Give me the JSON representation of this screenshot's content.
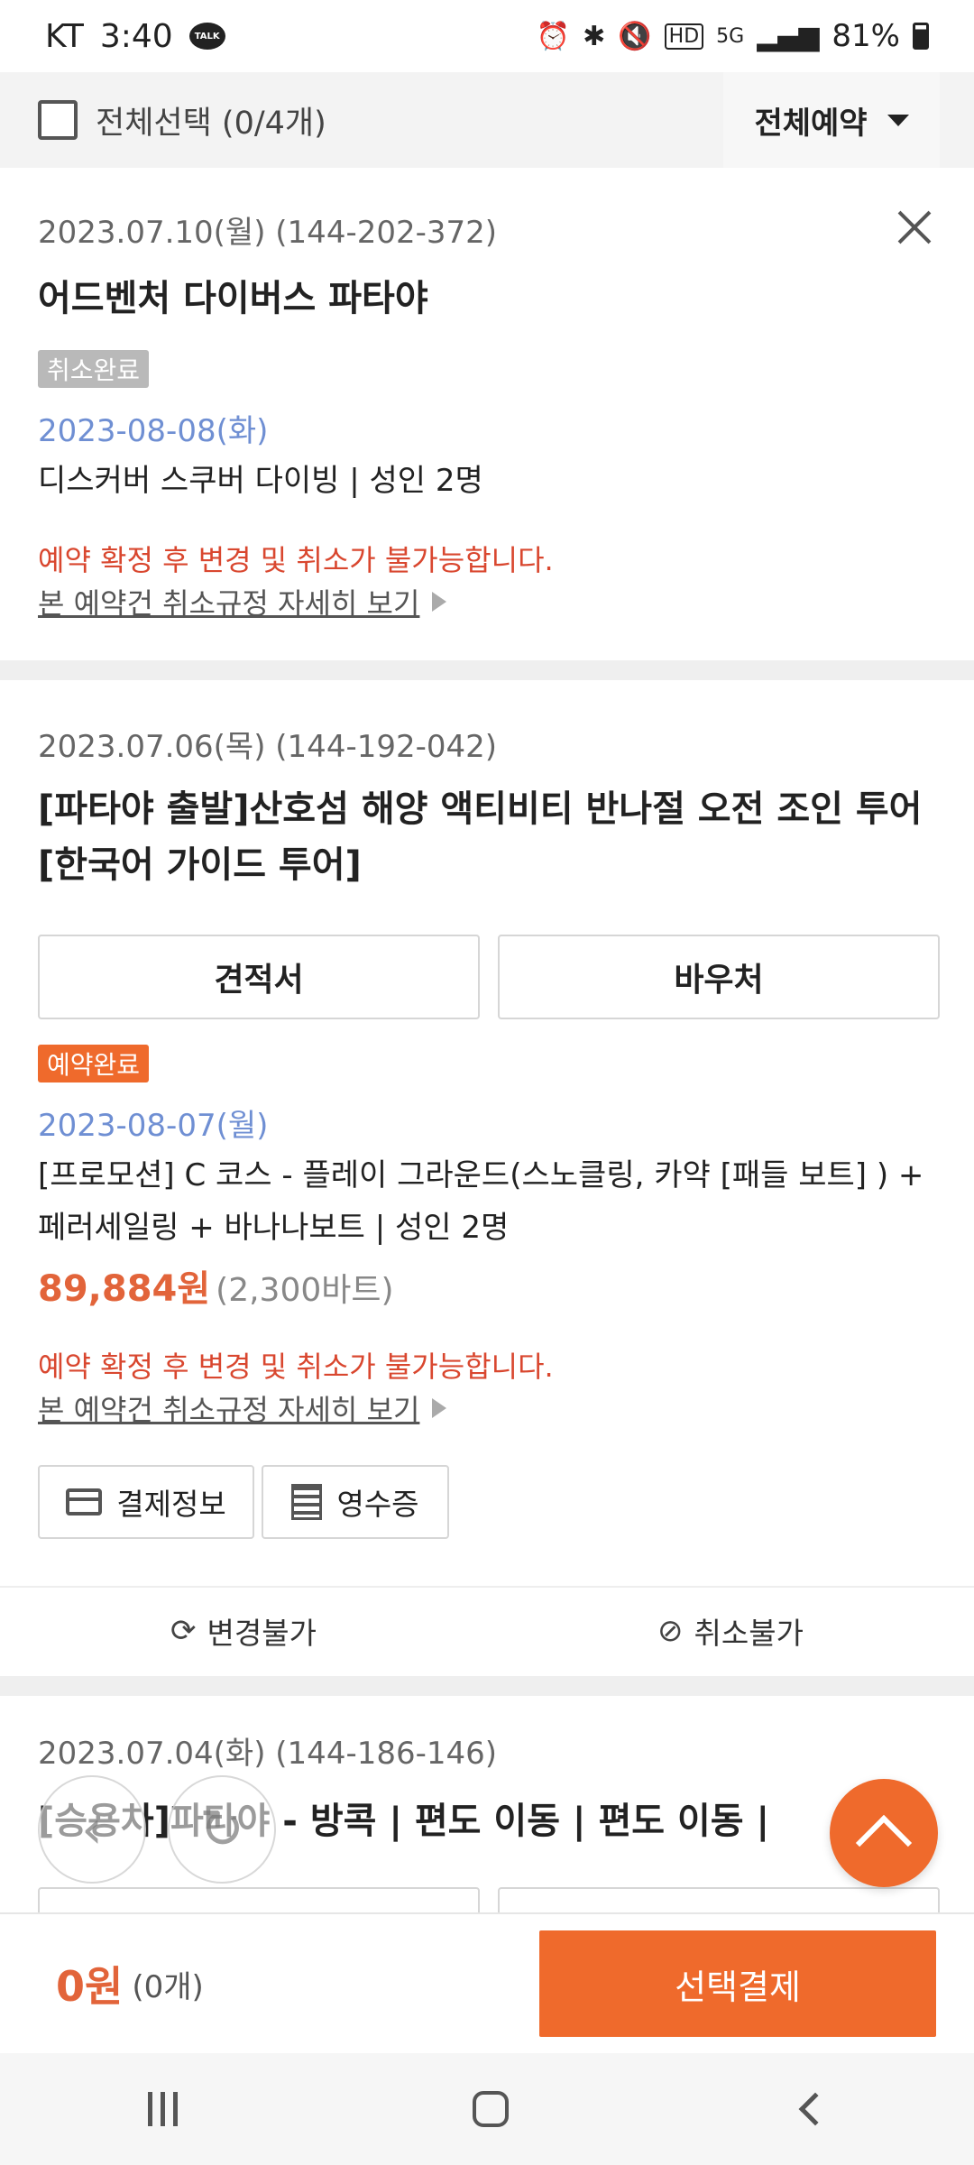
{
  "status_bar": {
    "carrier": "KT",
    "time": "3:40",
    "talk_badge": "TALK",
    "battery": "81%",
    "icons": [
      "alarm-icon",
      "bluetooth-icon",
      "mute-icon",
      "hd-icon",
      "5g-icon",
      "signal-icon",
      "battery-icon"
    ],
    "hd_label": "HD",
    "network_label": "5G"
  },
  "header": {
    "select_all_label": "전체선택 (0/4개)",
    "filter_label": "전체예약"
  },
  "bookings": [
    {
      "meta": "2023.07.10(월) (144-202-372)",
      "title": "어드벤처 다이버스 파타야",
      "status": "취소완료",
      "tour_date": "2023-08-08(화)",
      "option": "디스커버 스쿠버 다이빙 | 성인 2명",
      "warning": "예약 확정 후 변경 및 취소가 불가능합니다.",
      "policy_link": "본 예약건 취소규정 자세히 보기"
    },
    {
      "meta": "2023.07.06(목) (144-192-042)",
      "title": "[파타야 출발]산호섬 해양 액티비티 반나절 오전 조인 투어 [한국어 가이드 투어]",
      "estimate_btn": "견적서",
      "voucher_btn": "바우처",
      "status": "예약완료",
      "tour_date": "2023-08-07(월)",
      "option": "[프로모션] C 코스 - 플레이 그라운드(스노클링, 카약 [패들 보트] ) + 페러세일링 + 바나나보트 | 성인 2명",
      "price": "89,884원",
      "price_local": "(2,300바트)",
      "warning": "예약 확정 후 변경 및 취소가 불가능합니다.",
      "policy_link": "본 예약건 취소규정 자세히 보기",
      "payment_info_btn": "결제정보",
      "receipt_btn": "영수증",
      "change_label": "변경불가",
      "cancel_label": "취소불가"
    },
    {
      "meta": "2023.07.04(화) (144-186-146)",
      "title": "[승용차]파타야 - 방콕 | 편도 이동 | 편도 이동 |"
    }
  ],
  "footer": {
    "total": "0원",
    "count": "(0개)",
    "pay_button": "선택결제"
  },
  "colors": {
    "accent": "#ef6a2c",
    "warning": "#d9472f",
    "date_blue": "#6f8fd3",
    "price": "#e2643a"
  }
}
